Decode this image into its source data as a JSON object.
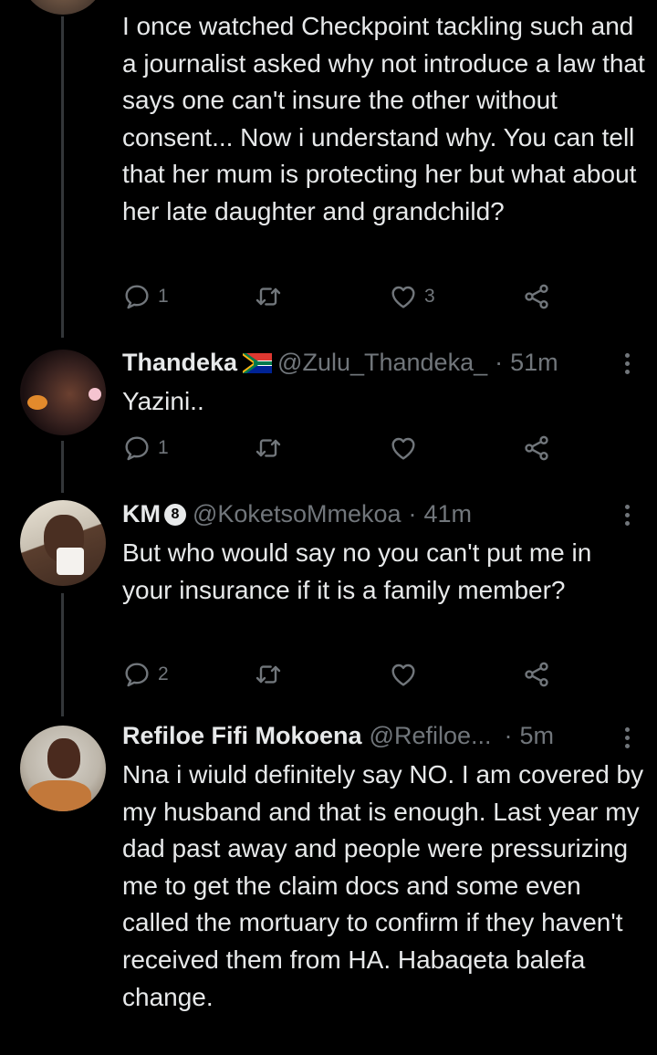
{
  "tweets": [
    {
      "body": "I once watched Checkpoint tackling such and a journalist asked why not introduce a law that says one can't insure the other without consent... Now i understand why. You can tell that her mum is protecting her but what about her late daughter and grandchild?",
      "replies": "1",
      "likes": "3"
    },
    {
      "name": "Thandeka",
      "handle": "@Zulu_Thandeka_",
      "time": "51m",
      "body": "Yazini..",
      "replies": "1",
      "likes": ""
    },
    {
      "name": "KM",
      "badge": "8",
      "handle": "@KoketsoMmekoa",
      "time": "41m",
      "body": "But who would say no you can't put me in your insurance if it is a family member?",
      "replies": "2",
      "likes": ""
    },
    {
      "name": "Refiloe Fifi Mokoena",
      "handle": "@Refiloe...",
      "time": "5m",
      "body": "Nna i wiuld definitely say NO. I am covered by my husband and that is enough. Last year my dad past away and people were pressurizing me to get the claim docs and some even called the mortuary to confirm if they haven't received them from HA. Habaqeta balefa change."
    }
  ],
  "separator": "·",
  "icons": [
    "reply-icon",
    "retweet-icon",
    "like-icon",
    "share-icon",
    "more-icon",
    "south-africa-flag-icon"
  ],
  "colors": {
    "background": "#000000",
    "text": "#e7e9ea",
    "muted": "#71767b",
    "thread_line": "#333639"
  }
}
